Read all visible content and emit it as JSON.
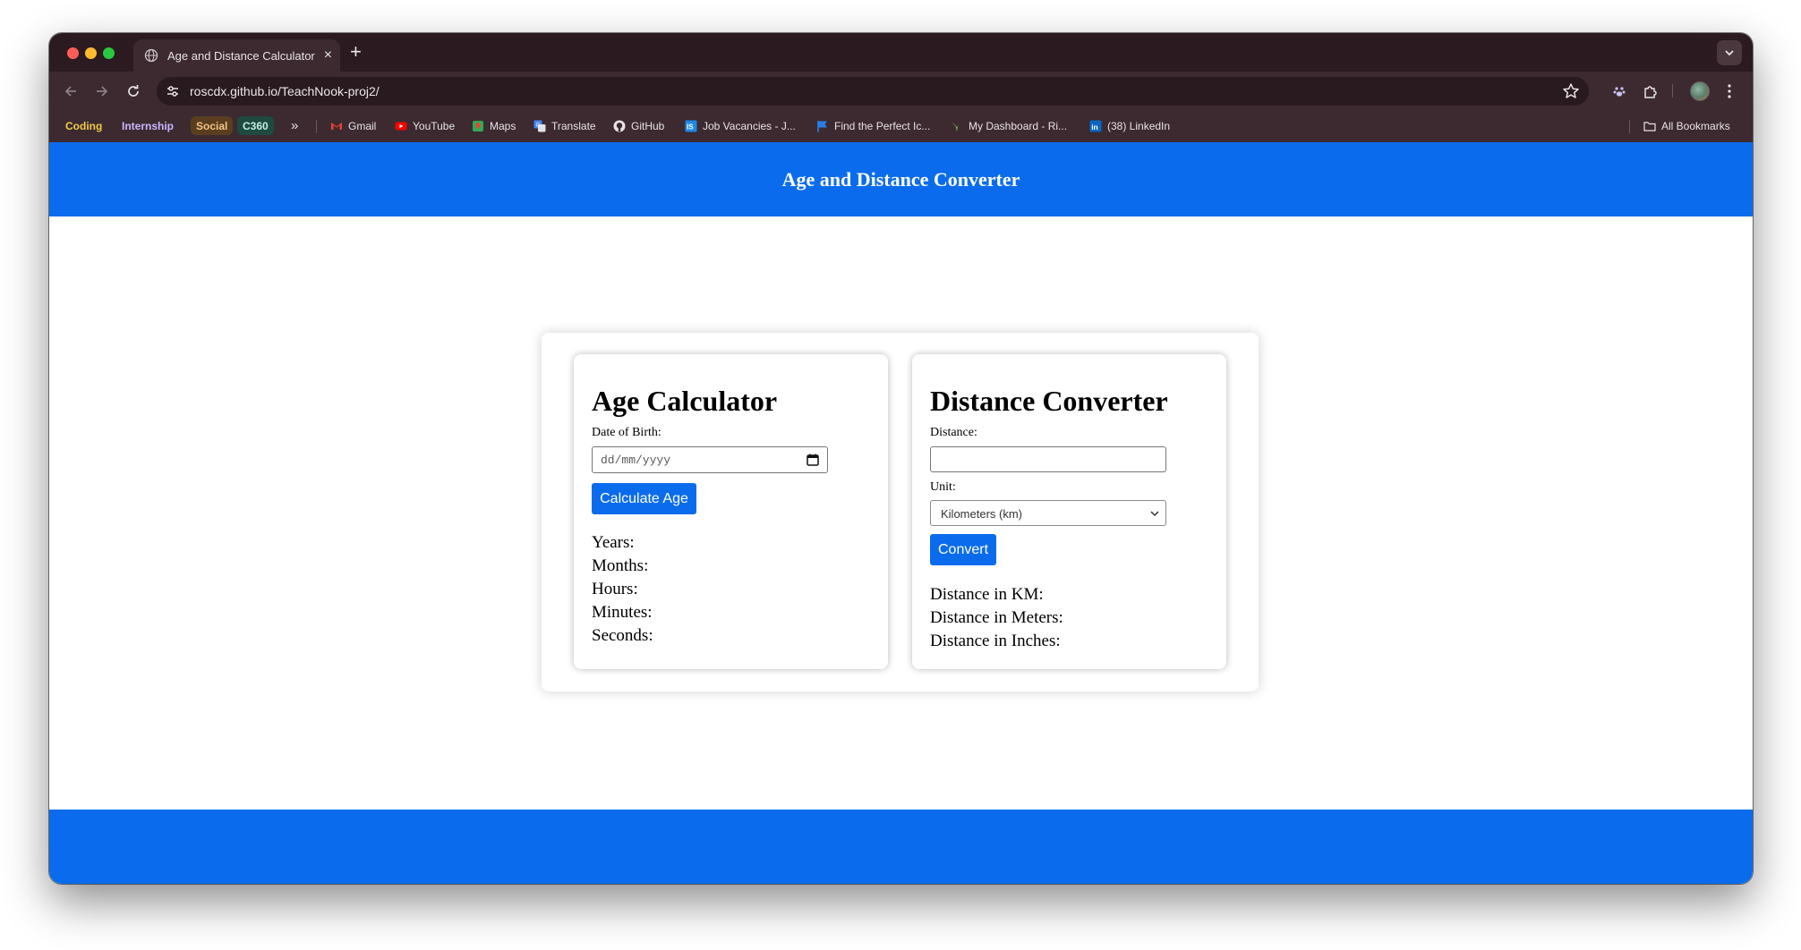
{
  "browser": {
    "tab_title": "Age and Distance Calculator",
    "url": "roscdx.github.io/TeachNook-proj2/",
    "bookmark_chips": [
      {
        "label": "Coding",
        "color": "#f2c94c",
        "bg": "#3c2a30"
      },
      {
        "label": "Internship",
        "color": "#c9b8ff",
        "bg": "#3c2a30"
      },
      {
        "label": "Social",
        "color": "#f4c38a",
        "bg": "#5a3e1f"
      },
      {
        "label": "C360",
        "color": "#bfeee2",
        "bg": "#1f4a40"
      }
    ],
    "more_bookmarks": "»",
    "bookmarks": [
      {
        "label": "Gmail",
        "icon": "gmail-icon"
      },
      {
        "label": "YouTube",
        "icon": "youtube-icon"
      },
      {
        "label": "Maps",
        "icon": "maps-icon"
      },
      {
        "label": "Translate",
        "icon": "translate-icon"
      },
      {
        "label": "GitHub",
        "icon": "github-icon"
      },
      {
        "label": "Job Vacancies - J...",
        "icon": "job-vacancies-icon"
      },
      {
        "label": "Find the Perfect Ic...",
        "icon": "flag-icon"
      },
      {
        "label": "My Dashboard - Ri...",
        "icon": "dashboard-icon"
      },
      {
        "label": "(38) LinkedIn",
        "icon": "linkedin-icon"
      }
    ],
    "all_bookmarks": "All Bookmarks"
  },
  "page": {
    "header_title": "Age and Distance Converter",
    "age": {
      "title": "Age Calculator",
      "dob_label": "Date of Birth:",
      "dob_placeholder": "dd/mm/yyyy",
      "button": "Calculate Age",
      "results": [
        "Years:",
        "Months:",
        "Hours:",
        "Minutes:",
        "Seconds:"
      ]
    },
    "distance": {
      "title": "Distance Converter",
      "distance_label": "Distance:",
      "distance_value": "",
      "unit_label": "Unit:",
      "unit_selected": "Kilometers (km)",
      "button": "Convert",
      "results": [
        "Distance in KM:",
        "Distance in Meters:",
        "Distance in Inches:"
      ]
    }
  },
  "colors": {
    "brand_blue": "#0a6ced",
    "chrome_dark": "#2b1a20",
    "chrome_toolbar": "#3c2a30"
  }
}
